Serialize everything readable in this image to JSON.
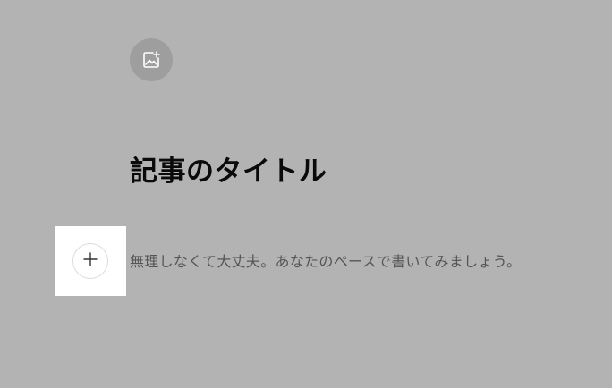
{
  "editor": {
    "cover_image_icon": "image-add-icon",
    "title": "記事のタイトル",
    "add_block_icon": "plus-icon",
    "body_placeholder": "無理しなくて大丈夫。あなたのペースで書いてみましょう。"
  },
  "colors": {
    "overlay_background": "#b3b3b3",
    "cover_button": "#9e9e9e",
    "title_text": "#0a0a0a",
    "placeholder_text": "#555555"
  }
}
